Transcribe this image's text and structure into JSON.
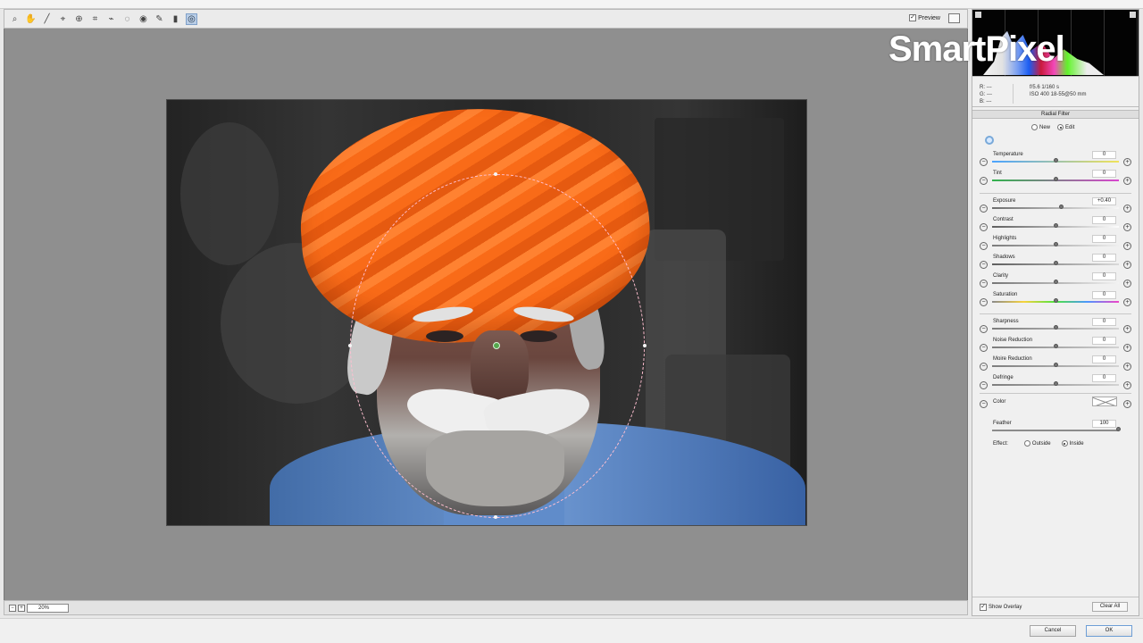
{
  "toolbar": {
    "tools": [
      {
        "name": "zoom-tool",
        "icon": "magnifier-icon",
        "glyph": "⌕"
      },
      {
        "name": "hand-tool",
        "icon": "hand-icon",
        "glyph": "✋"
      },
      {
        "name": "white-balance-tool",
        "icon": "eyedropper-icon",
        "glyph": "╱"
      },
      {
        "name": "color-sampler-tool",
        "icon": "color-sampler-icon",
        "glyph": "⌖"
      },
      {
        "name": "targeted-adjustment-tool",
        "icon": "target-adjust-icon",
        "glyph": "⊕"
      },
      {
        "name": "crop-tool",
        "icon": "crop-icon",
        "glyph": "⌗"
      },
      {
        "name": "straighten-tool",
        "icon": "straighten-icon",
        "glyph": "⌁"
      },
      {
        "name": "spot-removal-tool",
        "icon": "spot-removal-icon",
        "glyph": "◌"
      },
      {
        "name": "red-eye-tool",
        "icon": "red-eye-icon",
        "glyph": "◉"
      },
      {
        "name": "adjustment-brush-tool",
        "icon": "brush-icon",
        "glyph": "✎"
      },
      {
        "name": "graduated-filter-tool",
        "icon": "graduated-filter-icon",
        "glyph": "▮"
      },
      {
        "name": "radial-filter-tool",
        "icon": "radial-filter-icon",
        "glyph": "◎"
      }
    ],
    "preview_label": "Preview",
    "preview_checked": "✓"
  },
  "watermark": {
    "text": "SmartPixel"
  },
  "info": {
    "rgb": [
      "R: ---",
      "G: ---",
      "B: ---"
    ],
    "camera_line1": "f/5.6   1/160 s",
    "camera_line2": "ISO 400   18-55@50 mm"
  },
  "panel": {
    "title": "Radial Filter",
    "new_label": "New",
    "edit_label": "Edit",
    "adjustments": [
      {
        "label": "Temperature",
        "value": "0",
        "gradient": "linear-gradient(90deg,#4aa3ff,#f0e35a)",
        "slider": 0.5
      },
      {
        "label": "Tint",
        "value": "0",
        "gradient": "linear-gradient(90deg,#31b34d,#d946cf)",
        "slider": 0.5
      },
      {
        "label": "Exposure",
        "value": "+0.40",
        "gradient": "linear-gradient(90deg,#6d6d6d,#f7f7f7)",
        "slider": 0.55
      },
      {
        "label": "Contrast",
        "value": "0",
        "gradient": "linear-gradient(90deg,#5f5f5f,#fdfdfd)",
        "slider": 0.5
      },
      {
        "label": "Highlights",
        "value": "0",
        "gradient": "linear-gradient(90deg,#7b7b7b,#efefef)",
        "slider": 0.5
      },
      {
        "label": "Shadows",
        "value": "0",
        "gradient": "linear-gradient(90deg,#5f5f5f,#d9d9d9)",
        "slider": 0.5
      },
      {
        "label": "Clarity",
        "value": "0",
        "gradient": "linear-gradient(90deg,#777,#f2f2f2)",
        "slider": 0.5
      },
      {
        "label": "Saturation",
        "value": "0",
        "gradient": "linear-gradient(90deg,#8b8b8b,#f7d33d,#4de33f,#4c96ff,#f045c7)",
        "slider": 0.5
      },
      {
        "label": "Sharpness",
        "value": "0",
        "gradient": "linear-gradient(90deg,#7d7d7d,#d3d3d3)",
        "slider": 0.5
      },
      {
        "label": "Noise Reduction",
        "value": "0",
        "gradient": "linear-gradient(90deg,#7d7d7d,#d3d3d3)",
        "slider": 0.5
      },
      {
        "label": "Moire Reduction",
        "value": "0",
        "gradient": "linear-gradient(90deg,#7d7d7d,#d3d3d3)",
        "slider": 0.5
      },
      {
        "label": "Defringe",
        "value": "0",
        "gradient": "linear-gradient(90deg,#7d7d7d,#d3d3d3)",
        "slider": 0.5
      }
    ],
    "color_label": "Color",
    "feather_label": "Feather",
    "feather_value": "100",
    "effect_label": "Effect:",
    "effect_outside": "Outside",
    "effect_inside": "Inside",
    "show_overlay_label": "Show Overlay",
    "show_overlay_checked": "✓",
    "clear_all_label": "Clear All"
  },
  "status": {
    "zoom_value": "20%"
  },
  "dialog": {
    "cancel_label": "Cancel",
    "ok_label": "OK"
  },
  "colors": {
    "orange_turban": "#f96b18",
    "blue_shirt": "#5d89c8",
    "overlay_pink": "#ffbfd0"
  }
}
